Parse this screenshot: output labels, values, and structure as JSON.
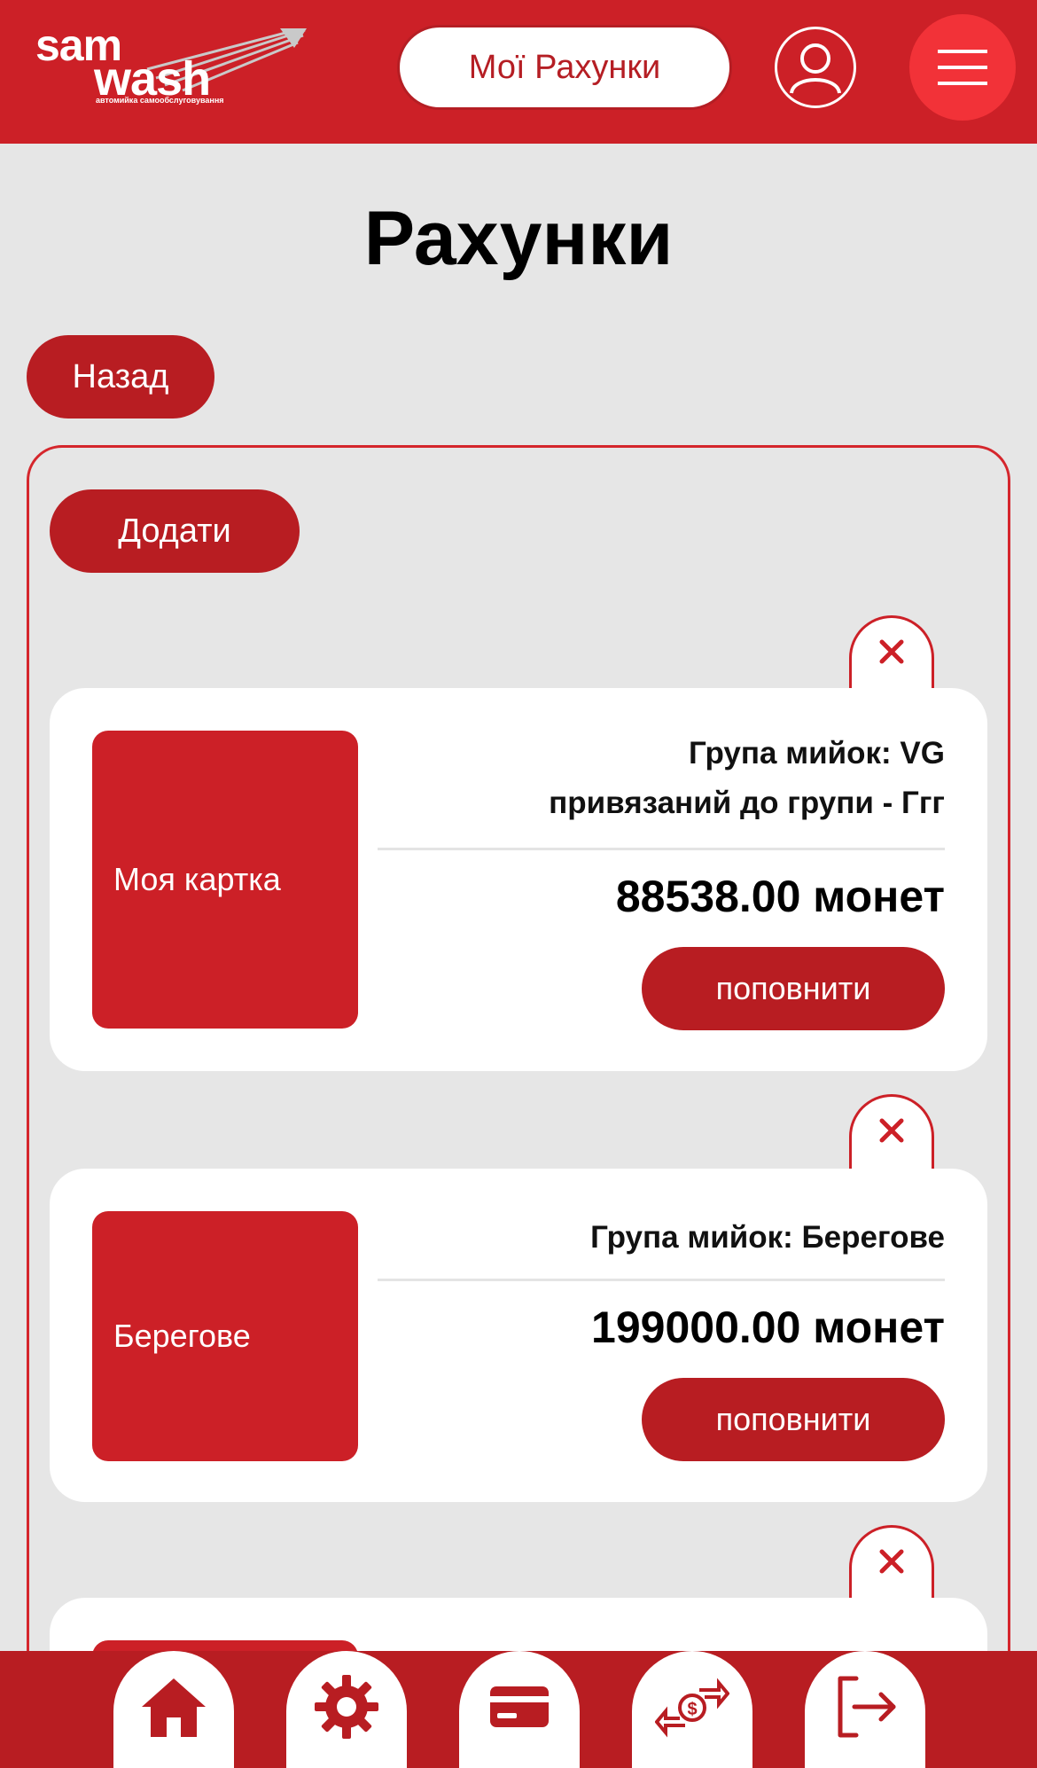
{
  "header": {
    "logo_top": "sam",
    "logo_bottom": "wash",
    "logo_tagline": "автомийка самообслуговування",
    "accounts_label": "Мої Рахунки"
  },
  "page": {
    "title": "Рахунки",
    "back_label": "Назад",
    "add_label": "Додати"
  },
  "cards": [
    {
      "name": "Моя картка",
      "group_line1": "Група мийок: VG",
      "group_line2": "привязаний до групи - Ггг",
      "balance": "88538.00 монет",
      "topup_label": "поповнити"
    },
    {
      "name": "Берегове",
      "group_line1": "Група мийок: Берегове",
      "balance": "199000.00 монет",
      "topup_label": "поповнити"
    }
  ],
  "colors": {
    "brand_red": "#cc2027",
    "button_red": "#b81d22",
    "menu_red": "#f23238",
    "background": "#e6e6e6"
  },
  "bottom_nav": [
    "home-icon",
    "settings-gear-icon",
    "card-icon",
    "money-exchange-icon",
    "logout-icon"
  ]
}
